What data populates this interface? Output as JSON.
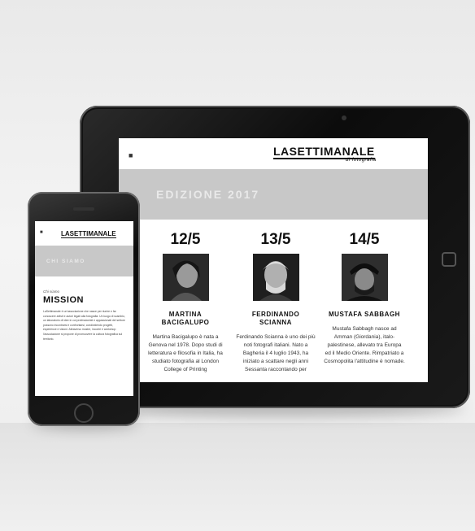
{
  "tablet": {
    "menu_icon": "menu-icon",
    "logo": "LASETTIMANALE",
    "logo_sub": "di fotografia",
    "edition": "EDIZIONE 2017",
    "photographers": [
      {
        "date": "12/5",
        "name": "MARTINA\nBACIGALUPO",
        "bio": "Martina Bacigalupo è nata a Genova nel 1978. Dopo studi di letteratura e filosofia in Italia, ha studiato fotografia al London College of Printing"
      },
      {
        "date": "13/5",
        "name": "FERDINANDO\nSCIANNA",
        "bio": "Ferdinando Scianna è uno dei più noti fotografi italiani. Nato a Bagheria il 4 luglio 1943, ha iniziato a scattare negli anni Sessanta raccontando per"
      },
      {
        "date": "14/5",
        "name": "MUSTAFA SABBAGH",
        "bio": "Mustafa Sabbagh nasce ad Amman (Giordania), italo-palestinese, allevato tra Europa ed il Medio Oriente. Rimpatriato a Cosmopolita l'attitudine è nomade."
      }
    ]
  },
  "phone": {
    "menu_icon": "menu-icon",
    "logo": "LASETTIMANALE",
    "banner": "CHI SIAMO",
    "kicker": "Chi siamo",
    "title": "MISSION",
    "text": "LaSettimanale è un'associazione che nasce per riunire e far conoscere artisti e autori legati alla fotografia. Un luogo di scambio, un laboratorio di idee in cui professionisti e appassionati del settore possono incontrarsi e confrontarsi, condividendo progetti, esperienze e visioni. Attraverso mostre, incontri e workshop l'associazione si propone di promuovere la cultura fotografica sul territorio."
  }
}
